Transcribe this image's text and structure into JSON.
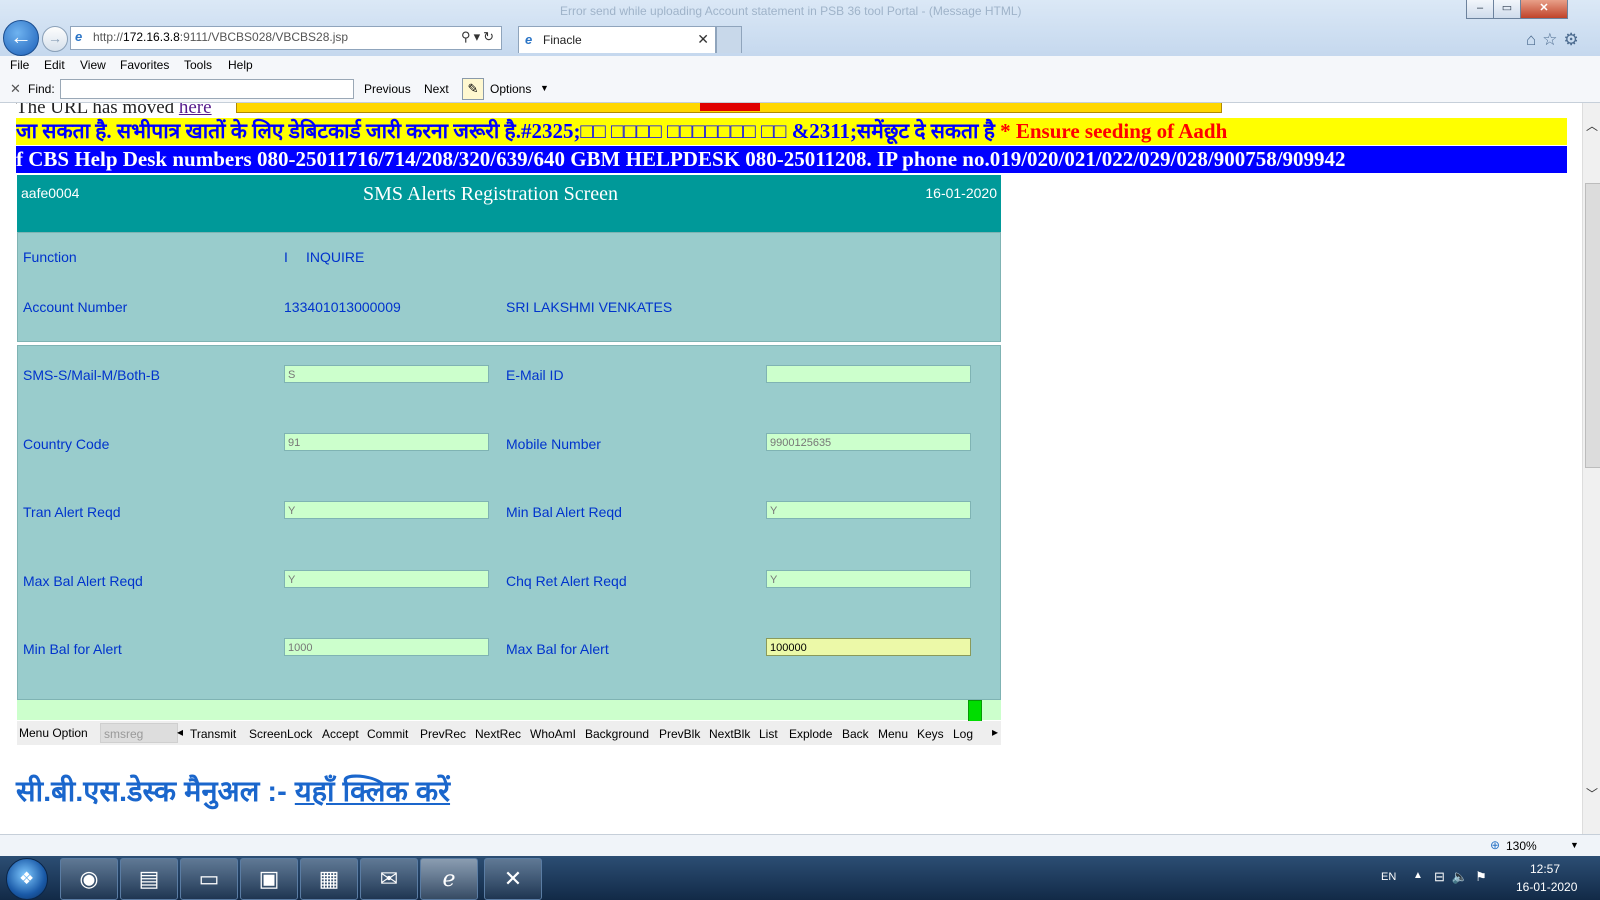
{
  "window": {
    "title": "Error send while uploading Account statement in PSB 36 tool Portal - (Message HTML)",
    "minimize": "‒",
    "maximize": "▭",
    "close": "✕"
  },
  "browser": {
    "address_prefix": "http://",
    "address_host": "172.16.3.8",
    "address_rest": ":9111/VBCBS028/VBCBS28.jsp",
    "tab_label": "Finacle",
    "tab_close": "✕"
  },
  "menubar": {
    "items": [
      "File",
      "Edit",
      "View",
      "Favorites",
      "Tools",
      "Help"
    ]
  },
  "findbar": {
    "close": "✕",
    "label": "Find:",
    "value": "",
    "previous": "Previous",
    "next": "Next",
    "options": "Options"
  },
  "notices": {
    "moved_text": "The URL has moved ",
    "moved_link": "here",
    "yellow_marquee": "जा सकता है. सभीपात्र खातों के लिए डेबिटकार्ड जारी करना जरूरी है.#2325;□□ □□□□ □□□□□□□ □□ &2311;समेंछूट दे सकता है",
    "yellow_marquee_red": " * Ensure seeding of Aadh",
    "blue_marquee": "f CBS Help Desk numbers 080-25011716/714/208/320/639/640 GBM HELPDESK 080-25011208. IP phone no.019/020/021/022/029/028/900758/909942"
  },
  "form": {
    "user": "aafe0004",
    "title": "SMS Alerts Registration Screen",
    "date": "16-01-2020",
    "function_label": "Function",
    "function_code": "I",
    "function_value": "INQUIRE",
    "account_label": "Account Number",
    "account_number": "133401013000009",
    "account_name": "SRI LAKSHMI VENKATES",
    "fields": {
      "sms_mode_label": "SMS-S/Mail-M/Both-B",
      "sms_mode_value": "S",
      "email_label": "E-Mail ID",
      "email_value": "",
      "country_code_label": "Country Code",
      "country_code_value": "91",
      "mobile_label": "Mobile Number",
      "mobile_value": "9900125635",
      "tran_alert_label": "Tran Alert Reqd",
      "tran_alert_value": "Y",
      "min_bal_alert_label": "Min Bal Alert Reqd",
      "min_bal_alert_value": "Y",
      "max_bal_alert_label": "Max Bal Alert Reqd",
      "max_bal_alert_value": "Y",
      "chq_ret_alert_label": "Chq Ret Alert Reqd",
      "chq_ret_alert_value": "Y",
      "min_bal_for_alert_label": "Min Bal for Alert",
      "min_bal_for_alert_value": "1000",
      "max_bal_for_alert_label": "Max Bal for Alert",
      "max_bal_for_alert_value": "100000"
    }
  },
  "menu_option": {
    "label": "Menu Option",
    "value": "smsreg",
    "buttons": [
      "Transmit",
      "ScreenLock",
      "Accept",
      "Commit",
      "PrevRec",
      "NextRec",
      "WhoAmI",
      "Background",
      "PrevBlk",
      "NextBlk",
      "List",
      "Explode",
      "Back",
      "Menu",
      "Keys",
      "Log"
    ]
  },
  "manual": {
    "prefix": "सी.बी.एस.डेस्क मैनुअल :- ",
    "link": "यहाँ क्लिक करें"
  },
  "statusbar": {
    "zoom": "130%"
  },
  "taskbar": {
    "language": "EN",
    "time": "12:57",
    "date": "16-01-2020"
  },
  "colors": {
    "form_header": "#009999",
    "form_body": "#99cccc",
    "field_bg": "#ccffcc",
    "label_text": "#0033cc",
    "marquee_yellow": "#ffff00",
    "marquee_blue": "#0000ff"
  }
}
